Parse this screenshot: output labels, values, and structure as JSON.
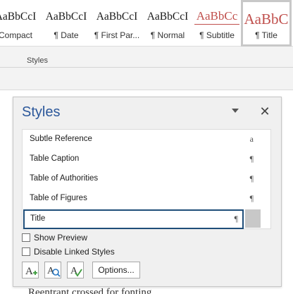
{
  "ribbon": {
    "gallery": [
      {
        "sample": "AaBbCcI",
        "name": "Compact"
      },
      {
        "sample": "AaBbCcI",
        "name": "¶ Date"
      },
      {
        "sample": "AaBbCcI",
        "name": "¶ First Par..."
      },
      {
        "sample": "AaBbCcI",
        "name": "¶ Normal"
      },
      {
        "sample": "AaBbCc",
        "name": "¶ Subtitle"
      },
      {
        "sample": "AaBbC",
        "name": "¶ Title"
      }
    ],
    "group_label": "Styles"
  },
  "pane": {
    "title": "Styles",
    "items": [
      {
        "label": "Subtle Reference",
        "symbol": "a"
      },
      {
        "label": "Table Caption",
        "symbol": "¶"
      },
      {
        "label": "Table of Authorities",
        "symbol": "¶"
      },
      {
        "label": "Table of Figures",
        "symbol": "¶"
      },
      {
        "label": "Title",
        "symbol": "¶"
      }
    ],
    "selected_item": "Title",
    "show_preview_label": "Show Preview",
    "disable_linked_label": "Disable Linked Styles",
    "options_label": "Options..."
  },
  "document": {
    "partial_text": "Reentrant crossed for fonting"
  },
  "colors": {
    "accent_blue": "#2b579a",
    "selection_border": "#1f4e79",
    "title_red": "#c0504d"
  }
}
